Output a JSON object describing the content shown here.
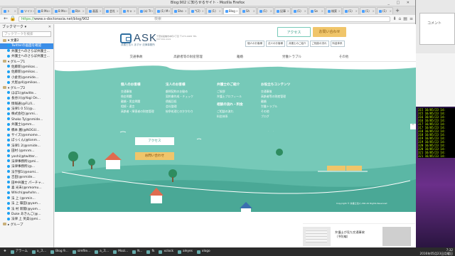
{
  "window": {
    "title": "Blog:902 に知らせるサイト - Mozilla Firefox",
    "controls": "_ □ ✕"
  },
  "tabs": [
    {
      "label": "ト"
    },
    {
      "label": "ツイト"
    },
    {
      "label": "B Mo"
    },
    {
      "label": "B Mo"
    },
    {
      "label": "B(e"
    },
    {
      "label": "画面"
    },
    {
      "label": "会社"
    },
    {
      "label": "キャ"
    },
    {
      "label": "(a) Tr"
    },
    {
      "label": "(1) M"
    },
    {
      "label": "Sho"
    },
    {
      "label": "*(2)"
    },
    {
      "label": "(1)"
    },
    {
      "label": "Blog",
      "active": true
    },
    {
      "label": "Sh"
    },
    {
      "label": "(1)"
    },
    {
      "label": "記事"
    },
    {
      "label": "(1)"
    },
    {
      "label": "Se"
    },
    {
      "label": "検索"
    },
    {
      "label": "(1)"
    },
    {
      "label": "(1)"
    },
    {
      "label": "(1)"
    }
  ],
  "navbar": {
    "url_https": "https://",
    "url_rest": "www.s-doctorasia.net/blog/902",
    "search_placeholder": "検索"
  },
  "sidebar": {
    "title": "ブックマーク ▾",
    "search_placeholder": "ブックマークを検索",
    "items": [
      {
        "label": "▾ 文書2",
        "icon": "folder"
      },
      {
        "label": "Twitterの画面を確認",
        "icon": "bird",
        "selected": true
      },
      {
        "label": "弁護士へのさらば弁護士...",
        "icon": "bird"
      },
      {
        "label": "弁護士へのさらば弁護士...",
        "icon": "bird"
      },
      {
        "label": "▾ グループ1",
        "icon": "folder"
      },
      {
        "label": "佐藤新(@mikas...",
        "icon": "bird"
      },
      {
        "label": "佐藤新(@mikas...",
        "icon": "bird"
      },
      {
        "label": "小倉亮(@nmide...",
        "icon": "bird"
      },
      {
        "label": "大屋@4(@mikas...",
        "icon": "bird"
      },
      {
        "label": "▾ グループ2",
        "icon": "folder"
      },
      {
        "label": "ほぼ1(@twitte...",
        "icon": "bird"
      },
      {
        "label": "長谷川(@Yogi On...",
        "icon": "bird"
      },
      {
        "label": "情報通(@FL/ll...",
        "icon": "bird"
      },
      {
        "label": "法律1 0 51(@...",
        "icon": "bird"
      },
      {
        "label": "株式会社(@nmi...",
        "icon": "bird"
      },
      {
        "label": "Shoko Ty(@nmide...",
        "icon": "bird"
      },
      {
        "label": "弁護士(@mm...",
        "icon": "bird"
      },
      {
        "label": "橋本 麗(@NOGU...",
        "icon": "bird"
      },
      {
        "label": "サイズ(@nmome...",
        "icon": "bird"
      },
      {
        "label": "ぼっくん(@tonm...",
        "icon": "bird"
      },
      {
        "label": "法律1 2(@nmide...",
        "icon": "bird"
      },
      {
        "label": "田村 (@mnm...",
        "icon": "bird"
      },
      {
        "label": "yoshi(@twitter...",
        "icon": "bird"
      },
      {
        "label": "法律事務所(@mi...",
        "icon": "bird"
      },
      {
        "label": "法律事務所(@...",
        "icon": "bird"
      },
      {
        "label": "法学部1(@nomi...",
        "icon": "bird"
      },
      {
        "label": "吉田(@nmide...",
        "icon": "bird"
      },
      {
        "label": "田中弁護士 パーチャ...",
        "icon": "bird"
      },
      {
        "label": "喜 光未(@nmomu...",
        "icon": "bird"
      },
      {
        "label": "Which(@whxhn...",
        "icon": "bird"
      },
      {
        "label": "法 上 (@nmin...",
        "icon": "bird"
      },
      {
        "label": "法 上 篠田(@yam...",
        "icon": "bird"
      },
      {
        "label": "法 村 新聞(@yom...",
        "icon": "bird"
      },
      {
        "label": "Duke あきんご(@...",
        "icon": "bird"
      },
      {
        "label": "法律 上 英美(@mi...",
        "icon": "bird"
      },
      {
        "label": "▸ グループ",
        "icon": "folder"
      }
    ]
  },
  "page": {
    "logo_text": "ASK",
    "logo_sub": "弁護士法人 あすか 法律事務所",
    "address": "千葉県船橋市本町2丁目 〒273-0005 TEL 047-4xx-xxxx",
    "access_btn": "アクセス",
    "contact_btn": "お問い合わせ",
    "quick_links": [
      "個人のお客様",
      "法人のお客様",
      "弁護士のご紹介",
      "ご相談の流れ",
      "料金体系"
    ],
    "global_nav": [
      "交通事故",
      "高齢者等の財産管理",
      "離婚",
      "労働トラブル",
      "その他"
    ],
    "footer_columns": [
      {
        "heading": "個人のお客様",
        "items": [
          "交通事故",
          "借金問題",
          "離婚・男女問題",
          "相続・遺言",
          "高齢者・障害者の財産管理"
        ]
      },
      {
        "heading": "法人のお客様",
        "items": [
          "顧問契約のお勧め",
          "契約書作成・チェック",
          "債権回収",
          "会社整理",
          "紛争処理とのかかわり"
        ]
      },
      {
        "heading": "弁護士のご紹介",
        "items": [
          "ご挨拶",
          "弁護士プロフィール"
        ]
      },
      {
        "heading": "お役立ちコンテンツ",
        "items": [
          "交通事故",
          "高齢者等の財産管理",
          "離婚",
          "労働トラブル",
          "その他",
          "ブログ"
        ]
      }
    ],
    "footer_column_extra": {
      "heading": "相談の流れ・料金",
      "items": [
        "ご相談の流れ",
        "料金体系"
      ]
    },
    "cta_access": "アクセス",
    "cta_contact": "お問い合わせ",
    "copyright": "Copyright © 弁護士法人 ASK All Rights Reserved",
    "page_top": "^",
    "related_card": {
      "text": "弁護士が見た交通事故（予防編）"
    }
  },
  "desktop": {
    "side_window_text": "コメント",
    "terminal_lines": [
      "315 16/05/23 14:",
      "315 16/05/23 14:",
      "316 16/05/23 14:",
      "316 16/05/23 14:",
      "317 16/05/23 14:",
      "317 16/05/23 14:",
      "318 16/05/23 14:",
      "318 16/05/23 14:",
      "319 16/05/23 14:",
      "319 16/05/23 14:",
      "320 16/05/23 14:",
      "320 16/05/23 14:",
      "321 16/05/23 14:",
      "321 16/05/23 14:"
    ]
  },
  "taskbar": {
    "items": [
      "アラーム",
      "a_ス...",
      "Blog 9...",
      "simfile...",
      "a_ス...",
      "Mozi...",
      "N...",
      "fk",
      "xclock",
      "aleyes",
      "xlogo"
    ],
    "clock_time": "7:32",
    "clock_date": "2016年05月23日月曜日"
  },
  "colors": {
    "teal": "#76c9b8",
    "accent_yellow": "#f0c56a",
    "selected_blue": "#3b8ee8"
  }
}
